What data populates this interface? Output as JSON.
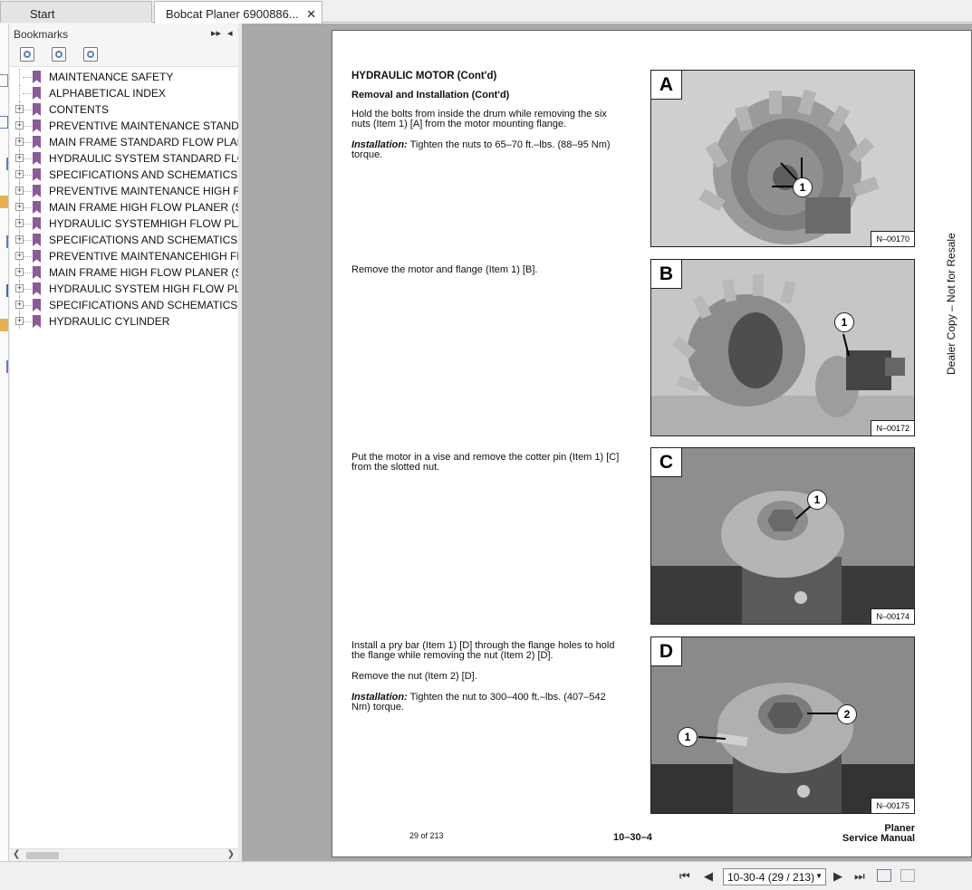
{
  "tabs": {
    "start": "Start",
    "document": "Bobcat Planer 6900886..."
  },
  "bookmarks": {
    "title": "Bookmarks",
    "items": [
      {
        "label": "MAINTENANCE SAFETY",
        "expandable": false
      },
      {
        "label": "ALPHABETICAL INDEX",
        "expandable": false
      },
      {
        "label": "CONTENTS",
        "expandable": true
      },
      {
        "label": "PREVENTIVE MAINTENANCE STANDA",
        "expandable": true
      },
      {
        "label": "MAIN FRAME STANDARD FLOW PLAN",
        "expandable": true
      },
      {
        "label": "HYDRAULIC SYSTEM STANDARD FLOV",
        "expandable": true
      },
      {
        "label": "SPECIFICATIONS AND SCHEMATICS S",
        "expandable": true
      },
      {
        "label": "PREVENTIVE MAINTENANCE HIGH FLO",
        "expandable": true
      },
      {
        "label": "MAIN FRAME HIGH FLOW PLANER (S/",
        "expandable": true
      },
      {
        "label": "HYDRAULIC SYSTEMHIGH FLOW PLAN",
        "expandable": true
      },
      {
        "label": "SPECIFICATIONS AND SCHEMATICSHI",
        "expandable": true
      },
      {
        "label": "PREVENTIVE MAINTENANCEHIGH FLO",
        "expandable": true
      },
      {
        "label": "MAIN FRAME HIGH FLOW PLANER (S/",
        "expandable": true
      },
      {
        "label": "HYDRAULIC SYSTEM HIGH FLOW PLA",
        "expandable": true
      },
      {
        "label": "SPECIFICATIONS AND SCHEMATICSHI",
        "expandable": true
      },
      {
        "label": "HYDRAULIC CYLINDER",
        "expandable": true
      }
    ]
  },
  "page": {
    "heading1": "HYDRAULIC MOTOR (Cont'd)",
    "heading2": "Removal and Installation (Cont'd)",
    "step_a": "Hold the bolts from inside the drum while removing the six nuts (Item 1) [A] from the motor mounting flange.",
    "install_a_label": "Installation:",
    "install_a": " Tighten the nuts to 65–70 ft.–lbs. (88–95 Nm) torque.",
    "step_b": "Remove the motor and flange (Item 1) [B].",
    "step_c": "Put the motor in a vise and remove the cotter pin (Item 1) [C] from the slotted nut.",
    "step_d1": "Install a pry bar (Item 1) [D] through the flange holes to hold the flange while removing the nut (Item 2) [D].",
    "step_d2": "Remove the nut (Item 2) [D].",
    "install_d_label": "Installation:",
    "install_d": " Tighten the nut to 300–400 ft.–lbs. (407–542 Nm) torque.",
    "figures": [
      {
        "letter": "A",
        "code": "N–00170"
      },
      {
        "letter": "B",
        "code": "N–00172"
      },
      {
        "letter": "C",
        "code": "N–00174"
      },
      {
        "letter": "D",
        "code": "N–00175"
      }
    ],
    "callout_1": "1",
    "callout_2": "2",
    "side_note": "Dealer Copy – Not for Resale",
    "page_count": "29 of 213",
    "page_code": "10–30–4",
    "footer_line1": "Planer",
    "footer_line2": "Service Manual"
  },
  "nav": {
    "page_field": "10-30-4 (29 / 213)"
  },
  "colors": {
    "bookmark": "#8a5a9a",
    "doc_background": "#a9a9a9"
  }
}
